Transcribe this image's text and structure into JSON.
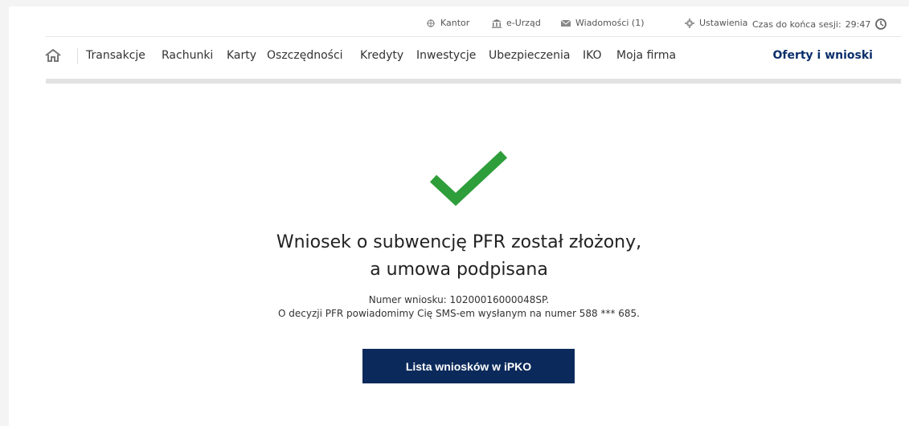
{
  "topbar": {
    "kantor": "Kantor",
    "eurzad": "e-Urząd",
    "messages": "Wiadomości (1)",
    "settings": "Ustawienia",
    "session_label": "Czas do końca sesji:",
    "session_time": "29:47"
  },
  "nav": {
    "items": [
      "Transakcje",
      "Rachunki",
      "Karty",
      "Oszczędności",
      "Kredyty",
      "Inwestycje",
      "Ubezpieczenia",
      "IKO",
      "Moja firma"
    ],
    "offers": "Oferty i wnioski"
  },
  "content": {
    "headline_line1": "Wniosek o subwencję PFR został złożony,",
    "headline_line2": "a umowa podpisana",
    "application_number": "Numer wniosku: 10200016000048SP.",
    "decision_notice": "O decyzji PFR powiadomimy Cię SMS-em wysłanym na numer 588 *** 685.",
    "button_label": "Lista wniosków w iPKO"
  },
  "colors": {
    "accent": "#0b2a5b",
    "success": "#2e9e3a"
  },
  "icons": [
    "kantor-icon",
    "bank-building-icon",
    "envelope-icon",
    "gear-icon",
    "clock-icon",
    "home-icon",
    "checkmark-icon"
  ]
}
